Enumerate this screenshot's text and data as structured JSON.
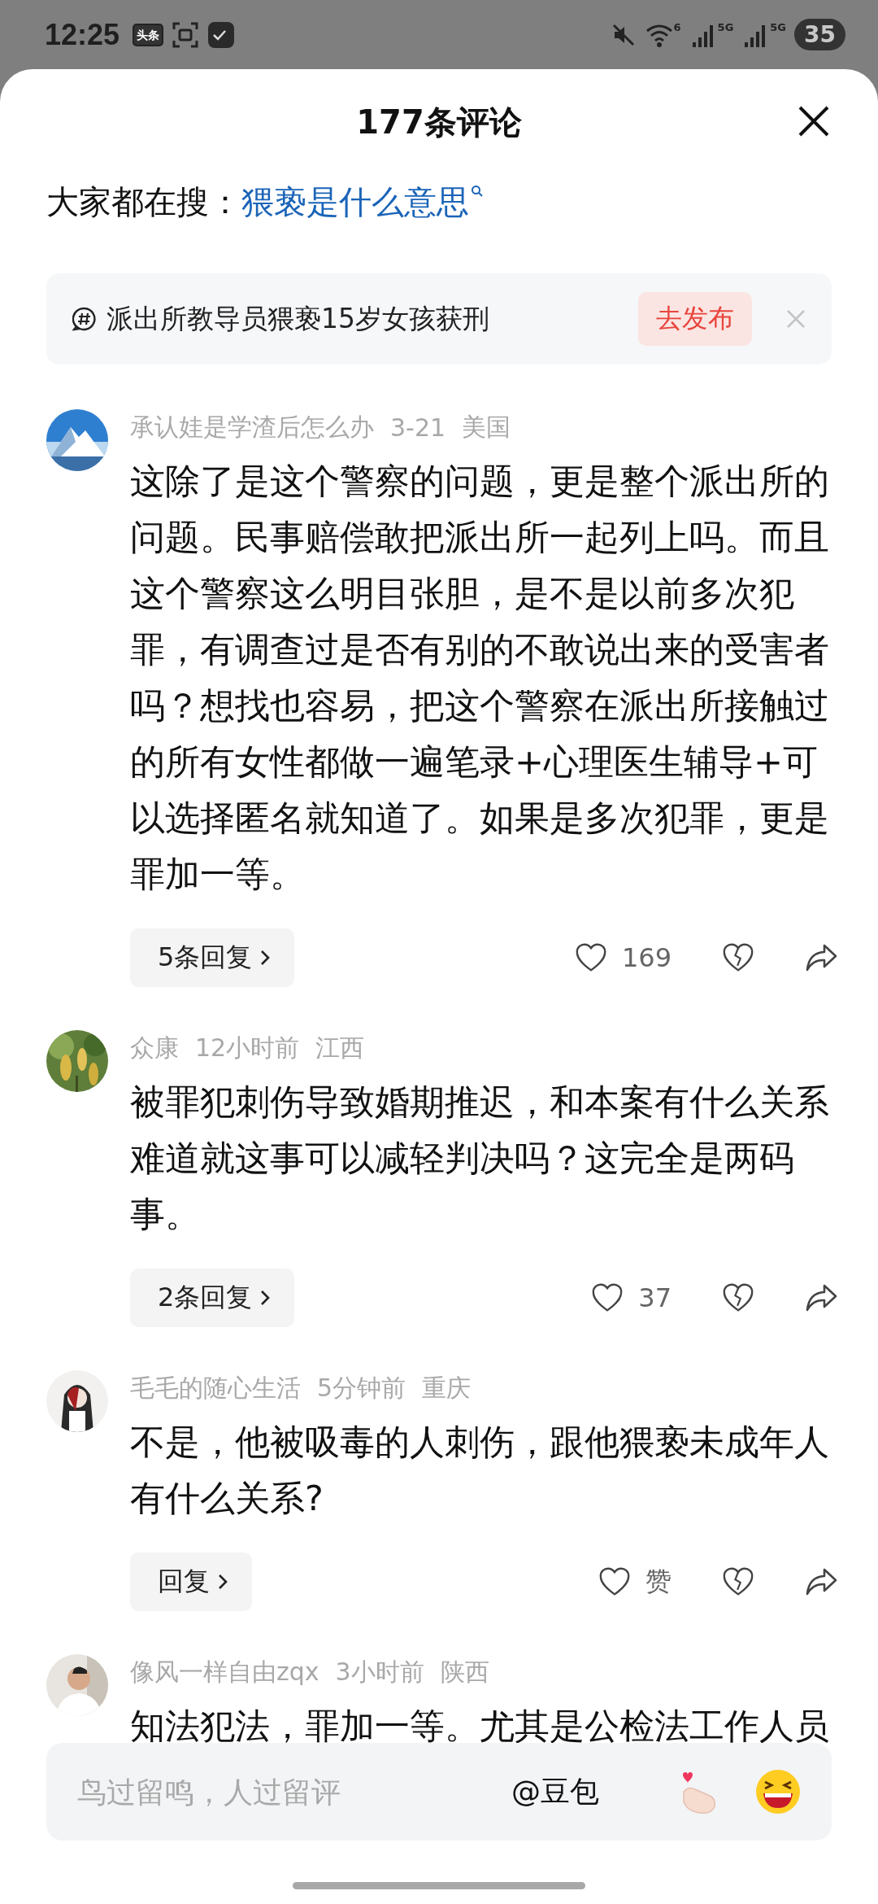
{
  "status_bar": {
    "time": "12:25",
    "app_badge": "头条",
    "network_labels": [
      "6",
      "5G",
      "5G"
    ],
    "battery": "35"
  },
  "header": {
    "title": "177条评论"
  },
  "trending_search": {
    "label": "大家都在搜：",
    "query": "猥亵是什么意思"
  },
  "topic_card": {
    "topic": "派出所教导员猥亵15岁女孩获刑",
    "button": "去发布"
  },
  "comments": [
    {
      "author": "承认娃是学渣后怎么办",
      "time": "3-21",
      "location": "美国",
      "text": "这除了是这个警察的问题，更是整个派出所的问题。民事赔偿敢把派出所一起列上吗。而且这个警察这么明目张胆，是不是以前多次犯罪，有调查过是否有别的不敢说出来的受害者吗？想找也容易，把这个警察在派出所接触过的所有女性都做一遍笔录+心理医生辅导+可以选择匿名就知道了。如果是多次犯罪，更是罪加一等。",
      "replies_button": "5条回复",
      "likes": "169"
    },
    {
      "author": "众康",
      "time": "12小时前",
      "location": "江西",
      "text": "被罪犯刺伤导致婚期推迟，和本案有什么关系难道就这事可以减轻判决吗？这完全是两码事。",
      "replies_button": "2条回复",
      "likes": "37"
    },
    {
      "author": "毛毛的随心生活",
      "time": "5分钟前",
      "location": "重庆",
      "text": "不是，他被吸毒的人刺伤，跟他猥亵未成年人有什么关系?",
      "replies_button": "回复",
      "likes": "赞"
    },
    {
      "author": "像风一样自由zqx",
      "time": "3小时前",
      "location": "陕西",
      "text": "知法犯法，罪加一等。尤其是公检法工作人员"
    }
  ],
  "comment_input": {
    "placeholder": "鸟过留鸣，人过留评",
    "mention": "@豆包"
  }
}
